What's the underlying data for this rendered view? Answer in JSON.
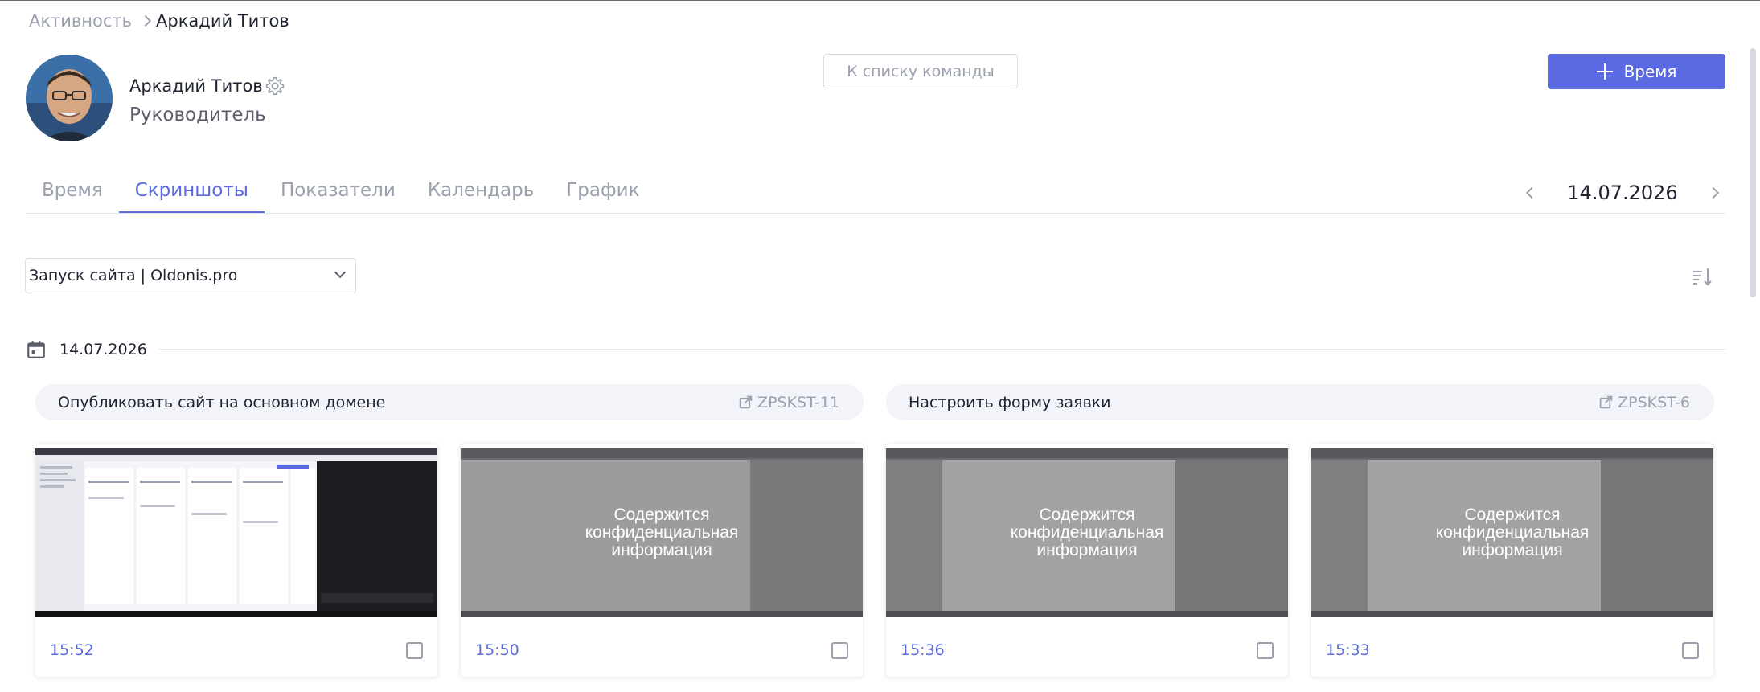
{
  "breadcrumb": {
    "parent": "Активность",
    "current": "Аркадий Титов"
  },
  "user": {
    "name": "Аркадий Титов",
    "role": "Руководитель"
  },
  "header": {
    "team_button": "К списку команды",
    "time_button": "Время"
  },
  "tabs": [
    {
      "label": "Время",
      "active": false
    },
    {
      "label": "Скриншоты",
      "active": true
    },
    {
      "label": "Показатели",
      "active": false
    },
    {
      "label": "Календарь",
      "active": false
    },
    {
      "label": "График",
      "active": false
    }
  ],
  "date_nav": {
    "date": "14.07.2026"
  },
  "project_select": {
    "value": "Запуск сайта | Oldonis.pro"
  },
  "day": {
    "date": "14.07.2026"
  },
  "tasks": [
    {
      "title": "Опубликовать сайт на основном домене",
      "code": "ZPSKST-11"
    },
    {
      "title": "Настроить форму заявки",
      "code": "ZPSKST-6"
    }
  ],
  "screenshots": [
    {
      "time": "15:52",
      "confidential": false,
      "overlay": ""
    },
    {
      "time": "15:50",
      "confidential": true,
      "overlay": "Содержится конфиденциальная информация"
    },
    {
      "time": "15:36",
      "confidential": true,
      "overlay": "Содержится конфиденциальная информация"
    },
    {
      "time": "15:33",
      "confidential": true,
      "overlay": "Содержится конфиденциальная информация"
    }
  ],
  "colors": {
    "accent": "#5b6ae0",
    "muted": "#9aa0ad",
    "task_bg": "#f3f4f9",
    "border": "#d9dce3"
  }
}
